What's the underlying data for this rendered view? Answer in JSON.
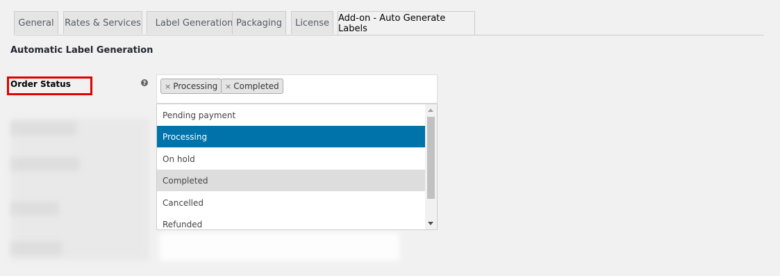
{
  "tabs": [
    {
      "label": "General"
    },
    {
      "label": "Rates & Services"
    },
    {
      "label": "Label Generation"
    },
    {
      "label": "Packaging"
    },
    {
      "label": "License"
    },
    {
      "label": "Add-on - Auto Generate Labels"
    }
  ],
  "section_title": "Automatic Label Generation",
  "order_status": {
    "label": "Order Status",
    "help_icon": "?",
    "selected_chips": [
      {
        "remove": "×",
        "label": "Processing"
      },
      {
        "remove": "×",
        "label": "Completed"
      }
    ],
    "options": [
      {
        "label": "Pending payment"
      },
      {
        "label": "Processing"
      },
      {
        "label": "On hold"
      },
      {
        "label": "Completed"
      },
      {
        "label": "Cancelled"
      },
      {
        "label": "Refunded"
      }
    ]
  },
  "colors": {
    "highlight_box": "#e00000",
    "selected_option": "#0073aa",
    "hover_option": "#dddddd"
  }
}
